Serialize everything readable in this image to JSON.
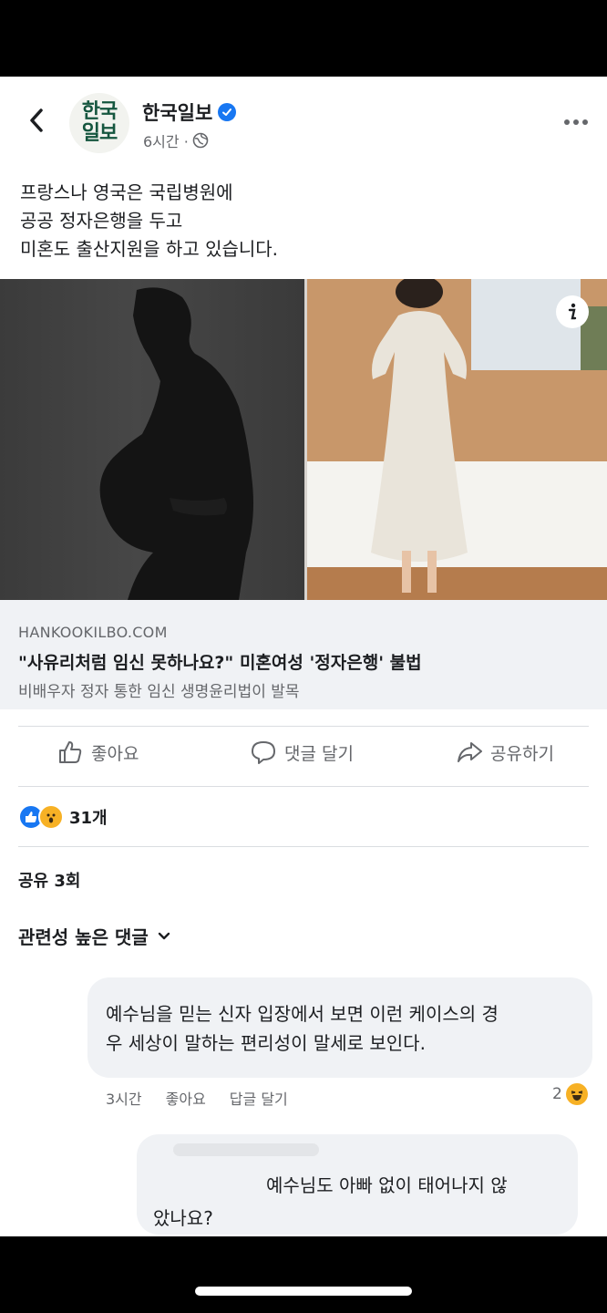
{
  "post": {
    "page_name": "한국일보",
    "logo_line1": "한국",
    "logo_line2": "일보",
    "time": "6시간 ·",
    "text_lines": [
      "프랑스나 영국은 국립병원에",
      "공공 정자은행을 두고",
      "미혼도 출산지원을 하고 있습니다."
    ]
  },
  "link_preview": {
    "domain": "HANKOOKILBO.COM",
    "title": "\"사유리처럼 임신 못하나요?\" 미혼여성 '정자은행' 불법",
    "description": "비배우자 정자 통한 임신 생명윤리법이 발목"
  },
  "actions": {
    "like": "좋아요",
    "comment": "댓글 달기",
    "share": "공유하기"
  },
  "reactions": {
    "count": "31개"
  },
  "shares": "공유 3회",
  "comment_sort": "관련성 높은 댓글",
  "comments": [
    {
      "lines": [
        "예수님을 믿는 신자 입장에서 보면 이런 케이스의 경",
        "우  세상이 말하는 편리성이 말세로 보인다."
      ],
      "time": "3시간",
      "like": "좋아요",
      "reply": "답글 달기",
      "reaction_count": "2"
    },
    {
      "line1": "예수님도 아빠 없이 태어나지 않",
      "line2": "았나요?"
    }
  ],
  "colors": {
    "facebook_blue": "#1877f2",
    "secondary_text": "#65676b",
    "bubble_bg": "#f0f2f5",
    "logo_green": "#15563f"
  }
}
